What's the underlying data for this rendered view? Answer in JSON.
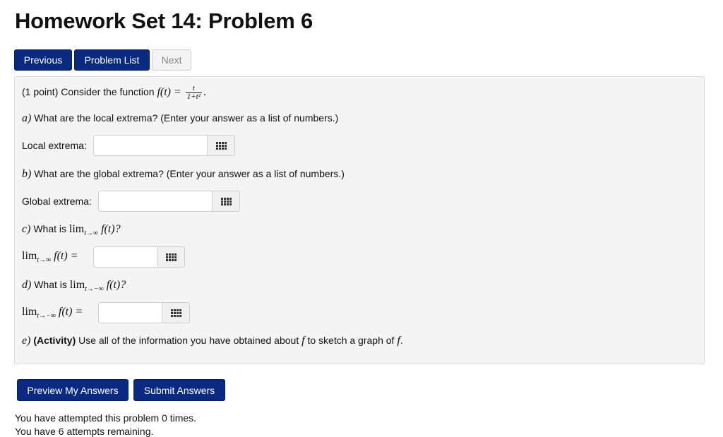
{
  "page": {
    "title": "Homework Set 14: Problem 6"
  },
  "nav": {
    "previous": "Previous",
    "problem_list": "Problem List",
    "next": "Next"
  },
  "problem": {
    "intro": "(1 point) Consider the function",
    "f_label": "f(t) =",
    "frac_num": "t",
    "frac_den": "1+t²",
    "intro_end": ".",
    "part_a": {
      "letter": "a)",
      "question": "What are the local extrema? (Enter your answer as a list of numbers.)",
      "label": "Local extrema:",
      "value": ""
    },
    "part_b": {
      "letter": "b)",
      "question": "What are the global extrema? (Enter your answer as a list of numbers.)",
      "label": "Global extrema:",
      "value": ""
    },
    "part_c": {
      "letter": "c)",
      "question_pre": "What is",
      "lim": "lim",
      "lim_sub": "t→∞",
      "question_expr": "f(t)?",
      "answer_expr": "f(t) =",
      "value": ""
    },
    "part_d": {
      "letter": "d)",
      "question_pre": "What is",
      "lim": "lim",
      "lim_sub": "t→−∞",
      "question_expr": "f(t)?",
      "answer_expr": "f(t) =",
      "value": ""
    },
    "part_e": {
      "letter": "e)",
      "activity": "(Activity)",
      "text_1": "Use all of the information you have obtained about",
      "f": "f",
      "text_2": "to sketch a graph of",
      "f2": "f",
      "end": "."
    }
  },
  "actions": {
    "preview": "Preview My Answers",
    "submit": "Submit Answers"
  },
  "status": {
    "attempted": "You have attempted this problem 0 times.",
    "remaining": "You have 6 attempts remaining."
  },
  "colors": {
    "primary_button": "#0a2a82",
    "panel_bg": "#f4f4f4"
  },
  "icons": {
    "answer_tool": "equation-editor-grid-icon"
  }
}
